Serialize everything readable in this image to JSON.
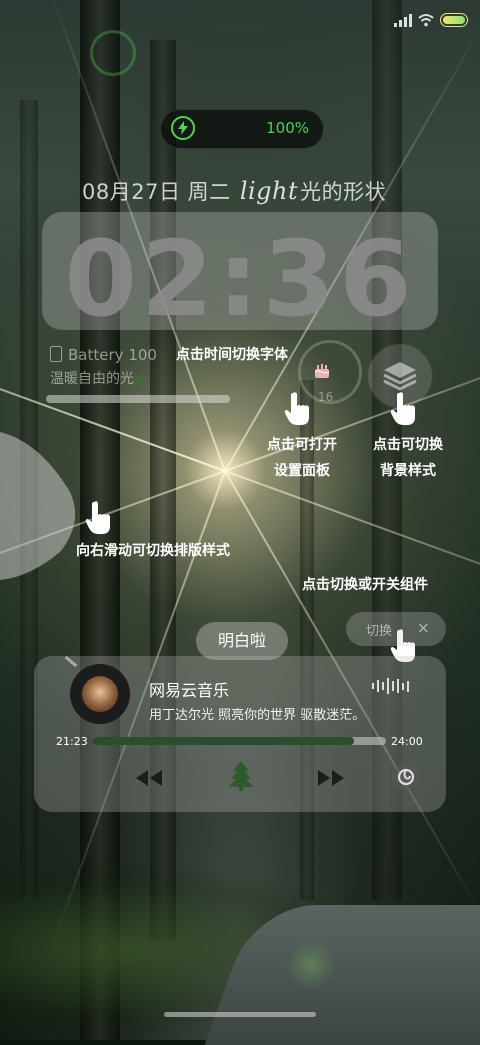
{
  "status_bar": {
    "icons": [
      "signal-icon",
      "wifi-icon",
      "battery-icon"
    ]
  },
  "charging": {
    "percent": "100%",
    "icon": "bolt-icon",
    "color": "#4fd152"
  },
  "date": {
    "prefix": "08月27日 周二",
    "script": "light",
    "suffix": "光的形状"
  },
  "clock": {
    "time": "02:36"
  },
  "battery_widget": {
    "label": "Battery",
    "value": "100",
    "motto": "温暖自由的光",
    "motto_icon": "tree-icon",
    "fill_fraction": 1.0
  },
  "hints": {
    "font": "点击时间切换字体",
    "settings_line1": "点击可打开",
    "settings_line2": "设置面板",
    "background_line1": "点击可切换",
    "background_line2": "背景样式",
    "swipe": "向右滑动可切换排版样式",
    "toggle": "点击切换或开关组件"
  },
  "ring_widget": {
    "label": "16",
    "icon": "cake-icon"
  },
  "layers_button": {
    "icon": "layers-icon"
  },
  "got_it_button": {
    "label": "明白啦"
  },
  "switch_pill": {
    "label": "切换",
    "close": "×"
  },
  "music": {
    "app": "网易云音乐",
    "lyric": "用丁达尔光 照亮你的世界 驱散迷茫。",
    "elapsed": "21:23",
    "duration": "24:00",
    "progress": 0.89,
    "center_icon": "tree-icon"
  },
  "colors": {
    "accent_green": "#4fd152",
    "progress_fill": "#2d4d2f"
  }
}
